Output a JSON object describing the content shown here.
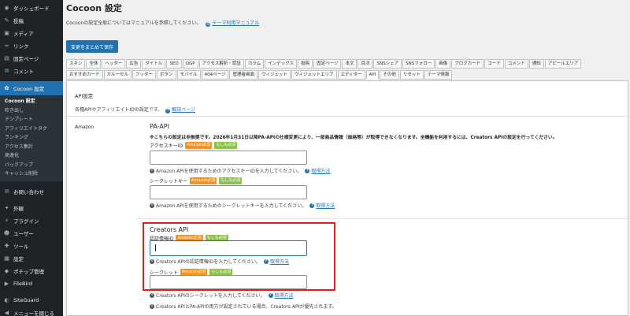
{
  "sidebar": {
    "items_top": [
      {
        "icon": "dashboard-icon",
        "glyph": "◉",
        "label": "ダッシュボード"
      },
      {
        "icon": "pin-icon",
        "glyph": "✎",
        "label": "投稿"
      },
      {
        "icon": "media-icon",
        "glyph": "▣",
        "label": "メディア"
      },
      {
        "icon": "link-icon",
        "glyph": "∞",
        "label": "リンク"
      },
      {
        "icon": "page-icon",
        "glyph": "▤",
        "label": "固定ページ"
      },
      {
        "icon": "comment-icon",
        "glyph": "✉",
        "label": "コメント"
      }
    ],
    "active": {
      "icon": "cocoon-icon",
      "glyph": "✿",
      "label": "Cocoon 設定"
    },
    "sub_items": [
      "Cocoon 設定",
      "吹き出し",
      "テンプレート",
      "アフィリエイトタグ",
      "ランキング",
      "アクセス集計",
      "高速化",
      "バックアップ",
      "キャッシュ削除"
    ],
    "items_bottom1": [
      {
        "icon": "mail-icon",
        "glyph": "✉",
        "label": "お問い合わせ"
      }
    ],
    "items_bottom2": [
      {
        "icon": "appearance-icon",
        "glyph": "✦",
        "label": "外観"
      },
      {
        "icon": "plugin-icon",
        "glyph": "⚡",
        "label": "プラグイン"
      },
      {
        "icon": "users-icon",
        "glyph": "☻",
        "label": "ユーザー"
      },
      {
        "icon": "tools-icon",
        "glyph": "✚",
        "label": "ツール"
      },
      {
        "icon": "settings-icon",
        "glyph": "▦",
        "label": "設定"
      },
      {
        "icon": "poppop-icon",
        "glyph": "◆",
        "label": "ポチップ管理"
      },
      {
        "icon": "filebird-icon",
        "glyph": "▶",
        "label": "FileBird"
      }
    ],
    "items_bottom3": [
      {
        "icon": "siteguard-icon",
        "glyph": "◐",
        "label": "SiteGuard"
      },
      {
        "icon": "collapse-icon",
        "glyph": "◀",
        "label": "メニューを閉じる"
      }
    ]
  },
  "header": {
    "title": "Cocoon 設定",
    "intro_text": "Cocoonの設定全般についてはマニュアルを参照してください。",
    "manual_link": "テーマ利用マニュアル"
  },
  "save_button": "変更をまとめて保存",
  "tabs_row1": [
    "スキン",
    "全体",
    "ヘッダー",
    "広告",
    "タイトル",
    "SEO",
    "OGP",
    "アクセス解析・認証",
    "カラム",
    "インデックス",
    "投稿",
    "固定ページ",
    "本文",
    "目次",
    "SNSシェア",
    "SNSフォロー",
    "画像",
    "ブログカード",
    "コード",
    "コメント",
    "通知",
    "アピールエリア"
  ],
  "tabs_row2": [
    "おすすめカード",
    "カルーセル",
    "フッター",
    "ボタン",
    "モバイル",
    "404ページ",
    "管理者画面",
    "ウィジェット",
    "ウィジェットエリア",
    "エディター",
    "API",
    "その他",
    "リセット",
    "テーマ情報"
  ],
  "active_tab": "API",
  "api": {
    "section_title": "API設定",
    "description": "各種APIやアフィリエイトIDの設定です。",
    "help_link": "解説ページ",
    "row_label": "Amazon",
    "pa_api": {
      "title": "PA-API",
      "warning": "※こちらの設定は非推奨です。2026年1月31日以降PA-APIの仕様変更により、一部商品情報（価格等）が取得できなくなります。全機能を利用するには、Creators APIの設定を行ってください。",
      "access_key_label": "アクセスキーID",
      "access_key_value": "",
      "access_key_hint": "Amazon APIを使用するためのアクセスキーIDを入力してください。",
      "secret_key_label": "シークレットキー",
      "secret_key_value": "",
      "secret_key_hint": "Amazon APIを使用するためのシークレットキーを入力してください。"
    },
    "creators": {
      "title": "Creators API",
      "credential_label": "認証情報ID",
      "credential_value": "",
      "credential_hint": "Creators APIの認証情報IDを入力してください。",
      "secret_label": "シークレット",
      "secret_value": "",
      "secret_hint": "Creators APIのシークレットを入力してください。",
      "priority_note": "Creators APIとPA-APIの両方が設定されている場合、Creators APIが優先されます。"
    },
    "badge_amazon": "Amazon必須",
    "badge_moshimo": "もしも必須",
    "howto_link": "取得方法"
  },
  "colors": {
    "accent": "#2271b1",
    "sidebar": "#1d2327",
    "highlight": "#e0201f",
    "badge_amazon": "#f7931e",
    "badge_moshimo": "#8bc34a"
  }
}
